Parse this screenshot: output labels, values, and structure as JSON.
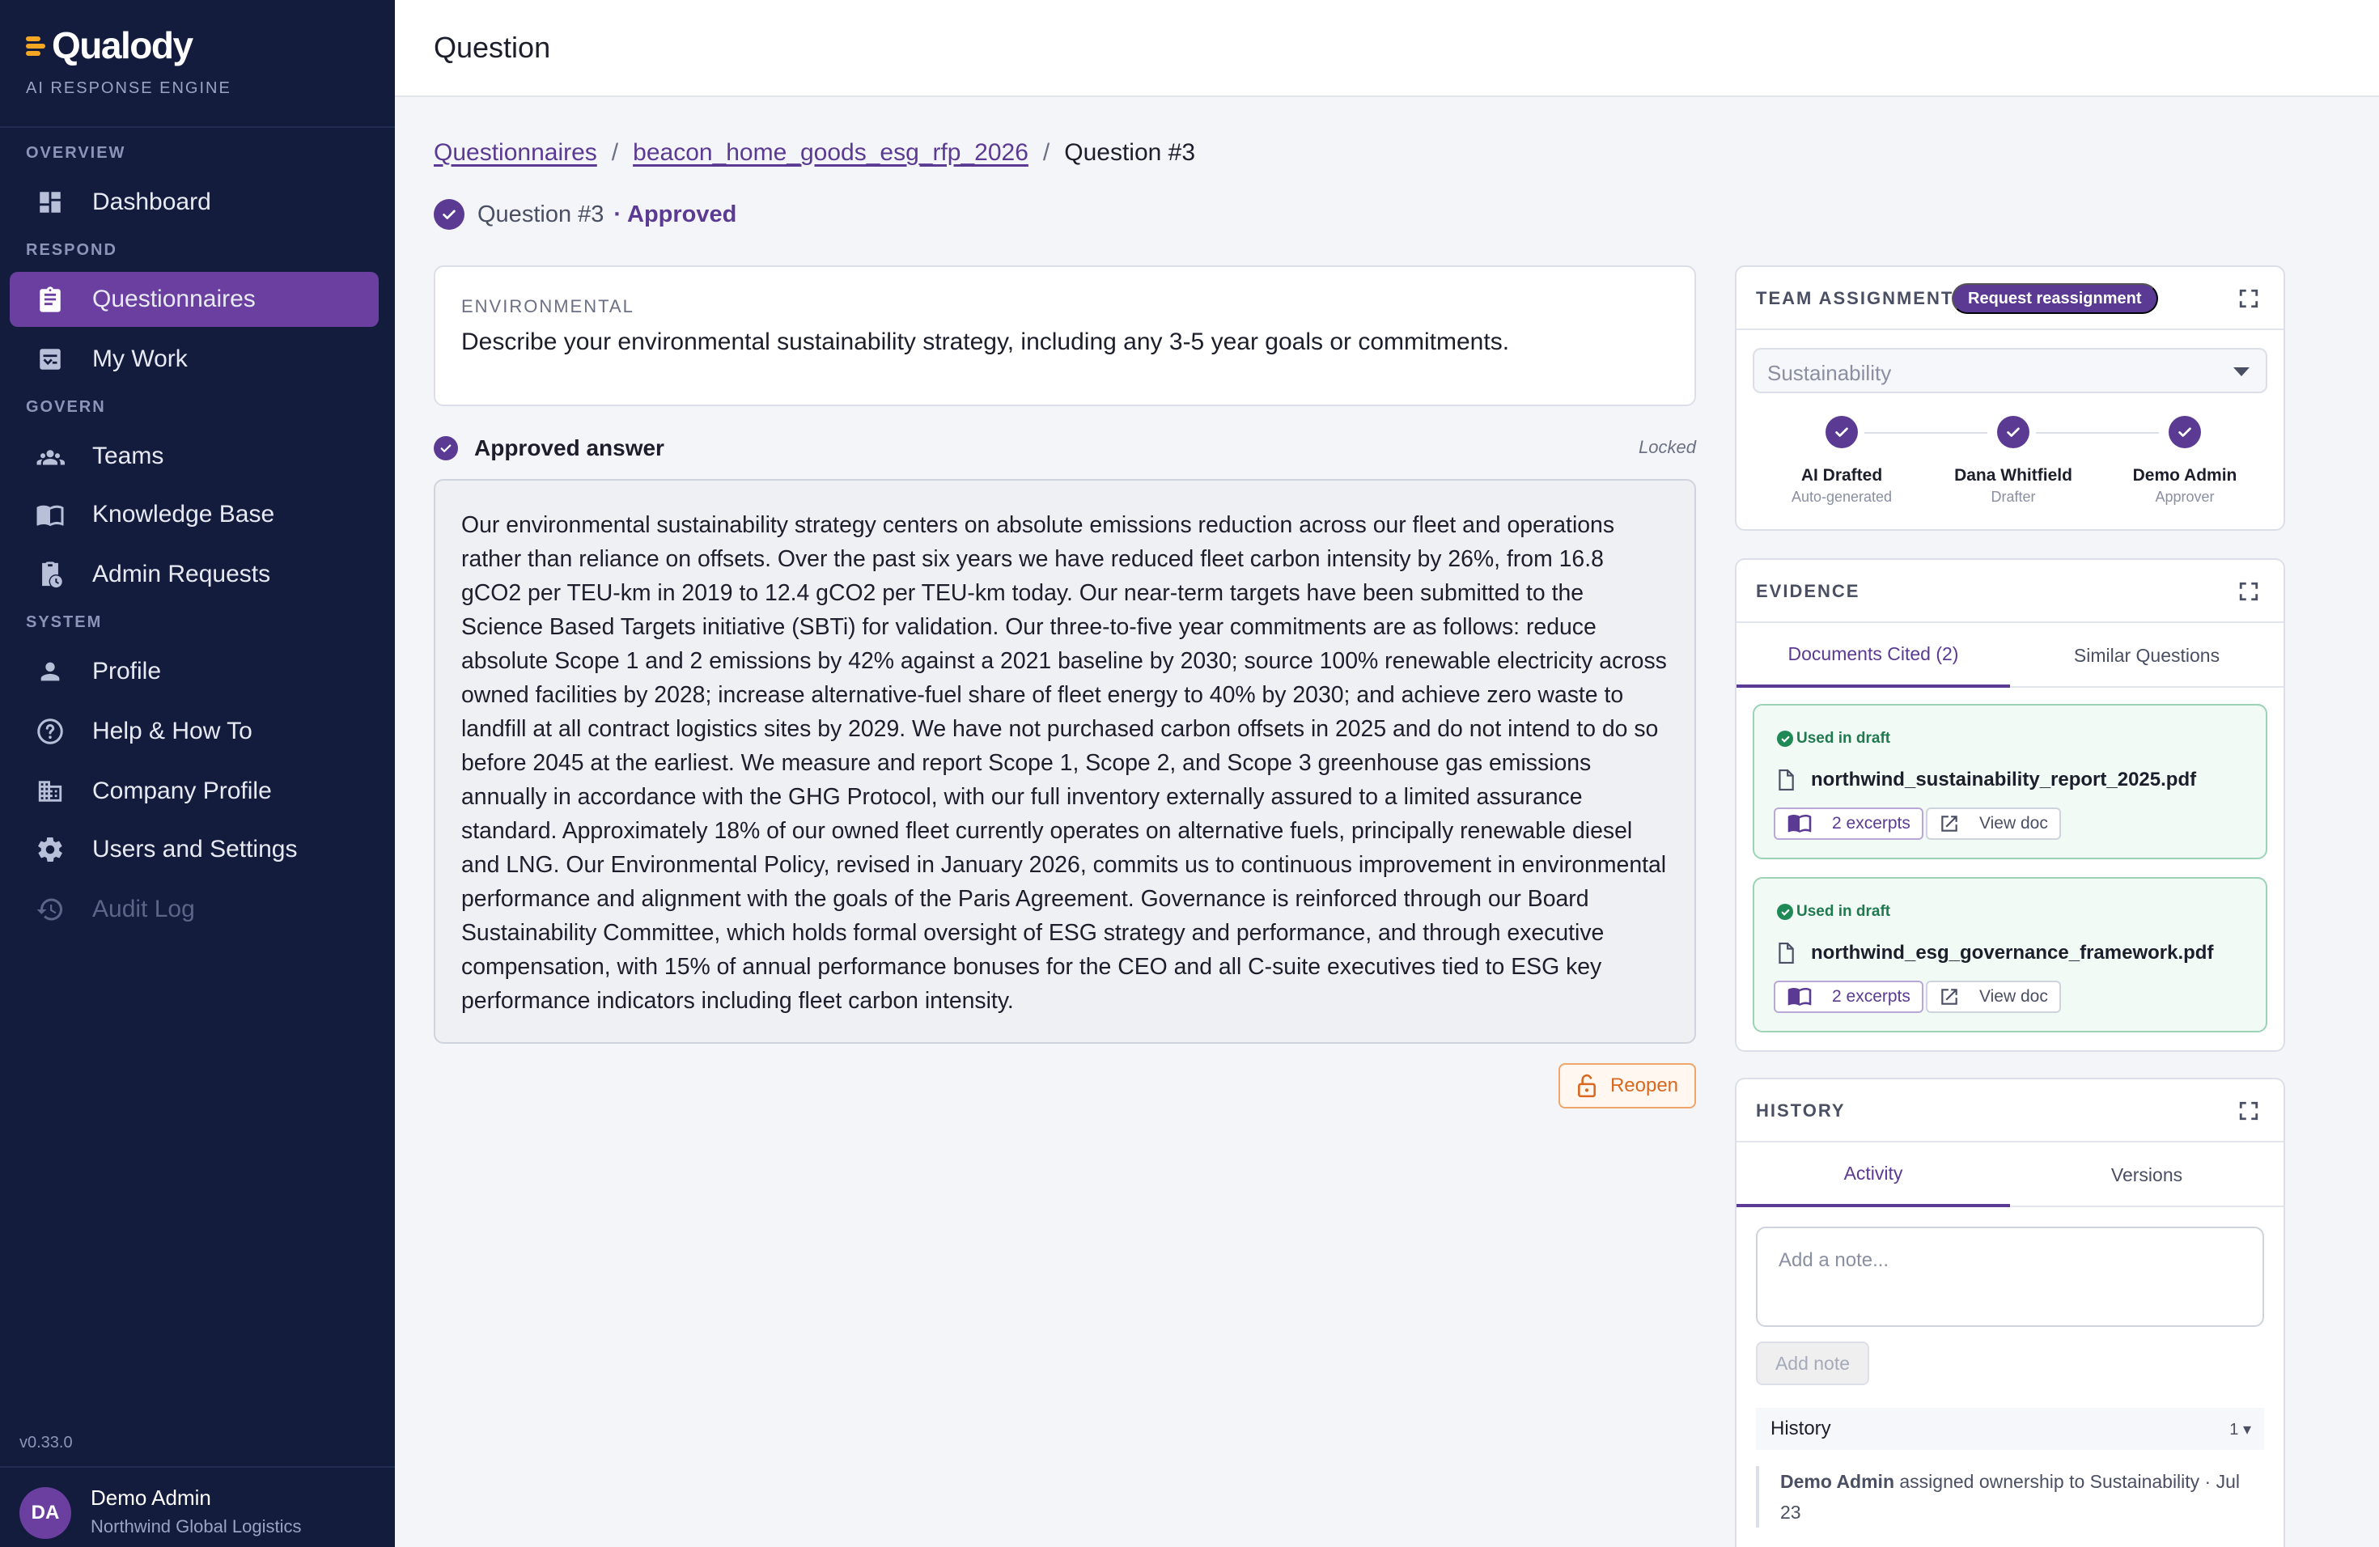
{
  "brand": {
    "name": "Qualody",
    "subtitle": "AI RESPONSE ENGINE"
  },
  "sidebar": {
    "sections": [
      {
        "label": "OVERVIEW"
      },
      {
        "label": "RESPOND"
      },
      {
        "label": "GOVERN"
      },
      {
        "label": "SYSTEM"
      }
    ],
    "items": [
      {
        "label": "Dashboard",
        "icon": "dashboard-icon"
      },
      {
        "label": "Questionnaires",
        "icon": "clipboard-icon",
        "active": true
      },
      {
        "label": "My Work",
        "icon": "checklist-icon"
      },
      {
        "label": "Teams",
        "icon": "team-icon"
      },
      {
        "label": "Knowledge Base",
        "icon": "book-icon"
      },
      {
        "label": "Admin Requests",
        "icon": "clipboard-clock-icon"
      },
      {
        "label": "Profile",
        "icon": "person-icon"
      },
      {
        "label": "Help & How To",
        "icon": "help-icon"
      },
      {
        "label": "Company Profile",
        "icon": "building-icon"
      },
      {
        "label": "Users and Settings",
        "icon": "gear-icon"
      },
      {
        "label": "Audit Log",
        "icon": "history-icon",
        "disabled": true
      }
    ],
    "version": "v0.33.0",
    "user": {
      "initials": "DA",
      "name": "Demo Admin",
      "org": "Northwind Global Logistics"
    }
  },
  "header": {
    "title": "Question"
  },
  "breadcrumb": {
    "root": "Questionnaires",
    "questionnaire": "beacon_home_goods_esg_rfp_2026",
    "current": "Question #3"
  },
  "status": {
    "question": "Question #3",
    "state": "· Approved"
  },
  "question": {
    "category": "ENVIRONMENTAL",
    "text": "Describe your environmental sustainability strategy, including any 3-5 year goals or commitments."
  },
  "answer": {
    "title": "Approved answer",
    "locked_label": "Locked",
    "text": "Our environmental sustainability strategy centers on absolute emissions reduction across our fleet and operations rather than reliance on offsets. Over the past six years we have reduced fleet carbon intensity by 26%, from 16.8 gCO2 per TEU-km in 2019 to 12.4 gCO2 per TEU-km today. Our near-term targets have been submitted to the Science Based Targets initiative (SBTi) for validation. Our three-to-five year commitments are as follows: reduce absolute Scope 1 and 2 emissions by 42% against a 2021 baseline by 2030; source 100% renewable electricity across owned facilities by 2028; increase alternative-fuel share of fleet energy to 40% by 2030; and achieve zero waste to landfill at all contract logistics sites by 2029. We have not purchased carbon offsets in 2025 and do not intend to do so before 2045 at the earliest. We measure and report Scope 1, Scope 2, and Scope 3 greenhouse gas emissions annually in accordance with the GHG Protocol, with our full inventory externally assured to a limited assurance standard. Approximately 18% of our owned fleet currently operates on alternative fuels, principally renewable diesel and LNG. Our Environmental Policy, revised in January 2026, commits us to continuous improvement in environmental performance and alignment with the goals of the Paris Agreement. Governance is reinforced through our Board Sustainability Committee, which holds formal oversight of ESG strategy and performance, and through executive compensation, with 15% of annual performance bonuses for the CEO and all C-suite executives tied to ESG key performance indicators including fleet carbon intensity.",
    "reopen_label": "Reopen"
  },
  "team": {
    "title": "TEAM ASSIGNMENT",
    "reassign_label": "Request reassignment",
    "selected_team": "Sustainability",
    "steps": [
      {
        "name": "AI Drafted",
        "role": "Auto-generated"
      },
      {
        "name": "Dana Whitfield",
        "role": "Drafter"
      },
      {
        "name": "Demo Admin",
        "role": "Approver"
      }
    ]
  },
  "evidence": {
    "title": "EVIDENCE",
    "tabs": [
      "Documents Cited (2)",
      "Similar Questions"
    ],
    "docs": [
      {
        "badge": "Used in draft",
        "name": "northwind_sustainability_report_2025.pdf",
        "excerpts": "2 excerpts",
        "view": "View doc"
      },
      {
        "badge": "Used in draft",
        "name": "northwind_esg_governance_framework.pdf",
        "excerpts": "2 excerpts",
        "view": "View doc"
      }
    ]
  },
  "history": {
    "title": "HISTORY",
    "tabs": [
      "Activity",
      "Versions"
    ],
    "note_placeholder": "Add a note...",
    "add_note_label": "Add note",
    "list_label": "History",
    "count": "1",
    "entry": {
      "actor": "Demo Admin",
      "text": "assigned ownership to Sustainability · Jul 23"
    }
  },
  "colors": {
    "sidebar": "#141c3e",
    "accent": "#5b3a93",
    "success": "#1f8a55",
    "warning": "#d8681f"
  }
}
